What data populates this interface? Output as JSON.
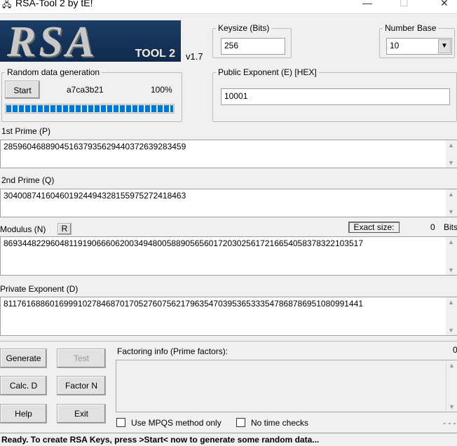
{
  "window": {
    "title": "RSA-Tool 2 by tE!",
    "minimize": "—",
    "maximize": "☐",
    "close": "✕"
  },
  "logo": {
    "text": "RSA",
    "subtext": "TOOL 2",
    "version": "v1.7"
  },
  "random": {
    "legend": "Random data generation",
    "start_label": "Start",
    "hash": "a7ca3b21",
    "percent_text": "100%",
    "progress": 1.0
  },
  "keysize": {
    "legend": "Keysize (Bits)",
    "value": "256"
  },
  "number_base": {
    "legend": "Number Base",
    "value": "10"
  },
  "public_exponent": {
    "legend": "Public Exponent (E) [HEX]",
    "value": "10001"
  },
  "prime_p": {
    "label": "1st Prime (P)",
    "value": "28596046889045163793562944037263928345​9"
  },
  "prime_q": {
    "label": "2nd Prime (Q)",
    "value": "304008741604601924494328155975272418463"
  },
  "modulus": {
    "label": "Modulus (N)",
    "r_button": "R",
    "exact_size_label": "Exact size:",
    "exact_size_value": "0",
    "bits_label": "Bits",
    "value": "86934482296048119190666062003494800588905656017203025617216654058378322103517"
  },
  "private_exponent": {
    "label": "Private Exponent (D)",
    "value": "81176168860169991027846870170527607562179635470395365333547868786951080991441"
  },
  "buttons": {
    "generate": "Generate",
    "test": "Test",
    "calc_d": "Calc. D",
    "factor_n": "Factor N",
    "help": "Help",
    "exit": "Exit"
  },
  "factoring": {
    "label": "Factoring info (Prime factors):",
    "count": "0",
    "dashes": "- - -"
  },
  "options": {
    "mpqs": "Use MPQS method only",
    "no_time": "No time checks"
  },
  "status": "Ready. To create RSA Keys, press >Start< now to generate some random data..."
}
